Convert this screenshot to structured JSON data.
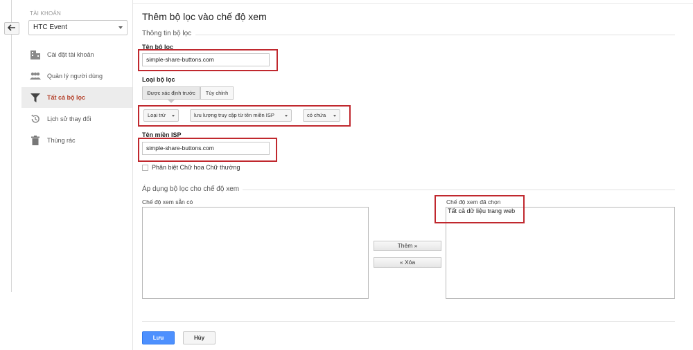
{
  "sidebar": {
    "account_label": "TÀI KHOẢN",
    "account_value": "HTC Event",
    "items": [
      {
        "label": "Cài đặt tài khoản",
        "icon": "building-icon"
      },
      {
        "label": "Quản lý người dùng",
        "icon": "users-icon"
      },
      {
        "label": "Tất cả bộ lọc",
        "icon": "filter-icon",
        "active": true
      },
      {
        "label": "Lịch sử thay đổi",
        "icon": "history-icon"
      },
      {
        "label": "Thùng rác",
        "icon": "trash-icon"
      }
    ]
  },
  "main": {
    "title": "Thêm bộ lọc vào chế độ xem",
    "filter_info_heading": "Thông tin bộ lọc",
    "filter_name_label": "Tên bộ lọc",
    "filter_name_value": "simple-share-buttons.com",
    "filter_type_label": "Loại bộ lọc",
    "filter_type_tabs": [
      "Được xác định trước",
      "Tùy chỉnh"
    ],
    "dropdowns": [
      "Loại trừ",
      "lưu lượng truy cập từ tên miền ISP",
      "có chứa"
    ],
    "isp_label": "Tên miền ISP",
    "isp_value": "simple-share-buttons.com",
    "case_sensitive_label": "Phân biệt Chữ hoa Chữ thường",
    "apply_heading": "Áp dụng bộ lọc cho chế độ xem",
    "available_views_label": "Chế độ xem sẵn có",
    "selected_views_label": "Chế độ xem đã chọn",
    "selected_views": [
      "Tất cả dữ liệu trang web"
    ],
    "add_button": "Thêm »",
    "remove_button": "« Xóa",
    "save_button": "Lưu",
    "cancel_button": "Hủy"
  },
  "colors": {
    "accent_red": "#c0282e",
    "active_nav_text": "#b5442e",
    "primary_blue": "#4d90fe"
  }
}
